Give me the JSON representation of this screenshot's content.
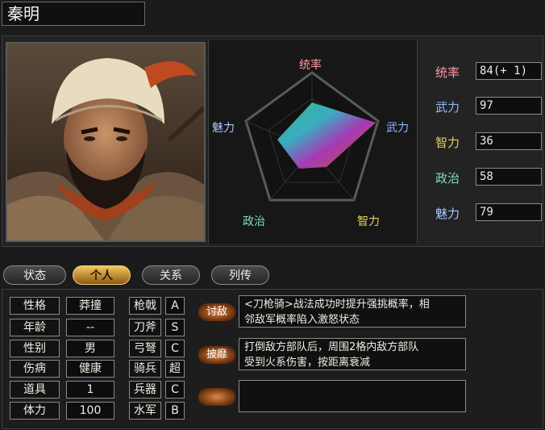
{
  "header": {
    "name": "秦明"
  },
  "radar": {
    "labels": {
      "command": "统率",
      "force": "武力",
      "intelligence": "智力",
      "politics": "政治",
      "charm": "魅力"
    },
    "label_colors": {
      "command": "#ff9aa0",
      "force": "#8fb8ff",
      "intelligence": "#e8d060",
      "politics": "#7fe0b0",
      "charm": "#a8c8ff"
    }
  },
  "stats": [
    {
      "label": "统率",
      "value": "84(+ 1)",
      "color": "#ff9aa0"
    },
    {
      "label": "武力",
      "value": "97",
      "color": "#8fb8ff"
    },
    {
      "label": "智力",
      "value": "36",
      "color": "#e8d060"
    },
    {
      "label": "政治",
      "value": "58",
      "color": "#7fe0b0"
    },
    {
      "label": "魅力",
      "value": "79",
      "color": "#a8c8ff"
    }
  ],
  "tabs": [
    {
      "label": "状态"
    },
    {
      "label": "个人",
      "active": true
    },
    {
      "label": "关系"
    },
    {
      "label": "列传"
    }
  ],
  "attributes": [
    {
      "label": "性格",
      "value": "莽撞"
    },
    {
      "label": "年龄",
      "value": "--"
    },
    {
      "label": "性别",
      "value": "男"
    },
    {
      "label": "伤病",
      "value": "健康"
    },
    {
      "label": "道具",
      "value": "1"
    },
    {
      "label": "体力",
      "value": "100"
    }
  ],
  "aptitudes": [
    {
      "label": "枪戟",
      "grade": "A"
    },
    {
      "label": "刀斧",
      "grade": "S"
    },
    {
      "label": "弓弩",
      "grade": "C"
    },
    {
      "label": "骑兵",
      "grade": "超"
    },
    {
      "label": "兵器",
      "grade": "C"
    },
    {
      "label": "水军",
      "grade": "B"
    }
  ],
  "skills": [
    {
      "name": "讨敌",
      "desc_line1": "<刀枪骑>战法成功时提升强挑概率，相",
      "desc_line2": "邻敌军概率陷入激怒状态"
    },
    {
      "name": "披靡",
      "desc_line1": "打倒敌方部队后，周围2格内敌方部队",
      "desc_line2": "受到火系伤害，按距离衰减"
    },
    {
      "name": "",
      "desc_line1": "",
      "desc_line2": ""
    }
  ]
}
